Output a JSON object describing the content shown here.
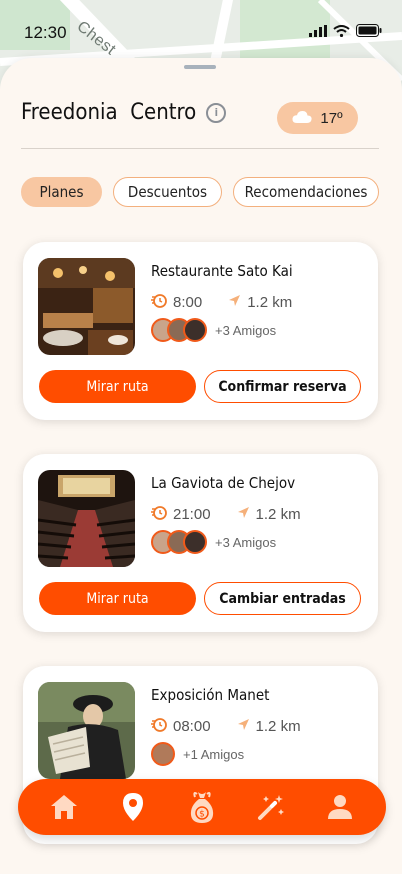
{
  "status": {
    "time": "12:30"
  },
  "map": {
    "street_label": "Chest"
  },
  "header": {
    "title": "Freedonia  Centro",
    "info_icon": "info-icon"
  },
  "weather": {
    "icon": "cloud-icon",
    "temperature": "17º"
  },
  "tabs": [
    {
      "label": "Planes",
      "active": true
    },
    {
      "label": "Descuentos",
      "active": false
    },
    {
      "label": "Recomendaciones",
      "active": false
    }
  ],
  "cards": [
    {
      "name": "Restaurante Sato Kai",
      "time": "8:00",
      "distance": "1.2 km",
      "friends": "+3 Amigos",
      "primary_label": "Mirar ruta",
      "secondary_label": "Confirmar reserva"
    },
    {
      "name": "La Gaviota de Chejov",
      "time": "21:00",
      "distance": "1.2 km",
      "friends": "+3 Amigos",
      "primary_label": "Mirar ruta",
      "secondary_label": "Cambiar entradas"
    },
    {
      "name": "Exposición Manet",
      "time": "08:00",
      "distance": "1.2 km",
      "friends": "+1 Amigos"
    }
  ],
  "bottom_nav": [
    "home-icon",
    "location-pin-icon",
    "money-bag-icon",
    "magic-wand-icon",
    "profile-icon"
  ],
  "colors": {
    "accent": "#ff4d00",
    "chip_active": "#f8c7a2",
    "background": "#fdf7f1"
  }
}
